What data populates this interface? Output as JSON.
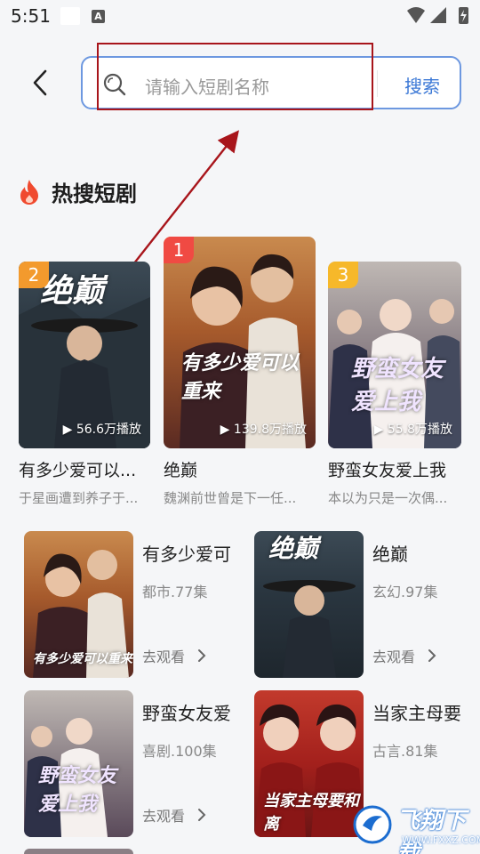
{
  "status_bar": {
    "time": "5:51"
  },
  "search": {
    "placeholder": "请输入短剧名称",
    "button_label": "搜索"
  },
  "section": {
    "title": "热搜短剧"
  },
  "top_cards": [
    {
      "rank": "2",
      "title": "有多少爱可以...",
      "desc": "于星画遭到养子于...",
      "plays": "56.6万播放",
      "poster_text": "绝巅",
      "badge_color": "#f39a2d"
    },
    {
      "rank": "1",
      "title": "绝巅",
      "desc": "魏渊前世曾是下一任...",
      "plays": "139.8万播放",
      "poster_text": "有多少爱可以重来",
      "badge_color": "#f04a43"
    },
    {
      "rank": "3",
      "title": "野蛮女友爱上我",
      "desc": "本以为只是一次偶...",
      "plays": "55.8万播放",
      "poster_text": "野蛮女友爱上我",
      "badge_color": "#f6b82a"
    }
  ],
  "list_cards": [
    {
      "title": "有多少爱可",
      "meta": "都市.77集",
      "watch": "去观看",
      "poster_text": "有多少爱可以重来"
    },
    {
      "title": "绝巅",
      "meta": "玄幻.97集",
      "watch": "去观看",
      "poster_text": "绝巅"
    },
    {
      "title": "野蛮女友爱",
      "meta": "喜剧.100集",
      "watch": "去观看",
      "poster_text": "野蛮女友爱上我"
    },
    {
      "title": "当家主母要",
      "meta": "古言.81集",
      "watch": "",
      "poster_text": "当家主母要和离"
    }
  ],
  "watermark": {
    "text": "飞翔下载",
    "url": "WWW.FXXZ.COM"
  }
}
